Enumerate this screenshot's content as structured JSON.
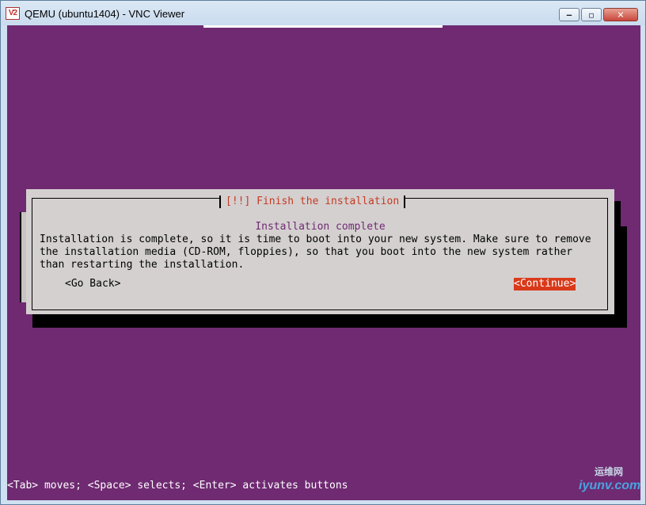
{
  "window": {
    "title": "QEMU (ubuntu1404) - VNC Viewer",
    "icon_label": "V2",
    "controls": {
      "minimize": "‒",
      "maximize": "▫",
      "close": "✕"
    }
  },
  "dialog": {
    "title": "[!!] Finish the installation",
    "subtitle": "Installation complete",
    "body": "Installation is complete, so it is time to boot into your new system. Make sure to remove\nthe installation media (CD-ROM, floppies), so that you boot into the new system rather\nthan restarting the installation.",
    "go_back": "<Go Back>",
    "continue": "<Continue>"
  },
  "status_line": "<Tab> moves; <Space> selects; <Enter> activates buttons",
  "watermark": {
    "text": "iyunv.com",
    "cn": "运维网"
  },
  "colors": {
    "background": "#6f2a72",
    "dialog": "#d4d0d0",
    "accent": "#d93a1a",
    "title_text": "#c43b22"
  }
}
